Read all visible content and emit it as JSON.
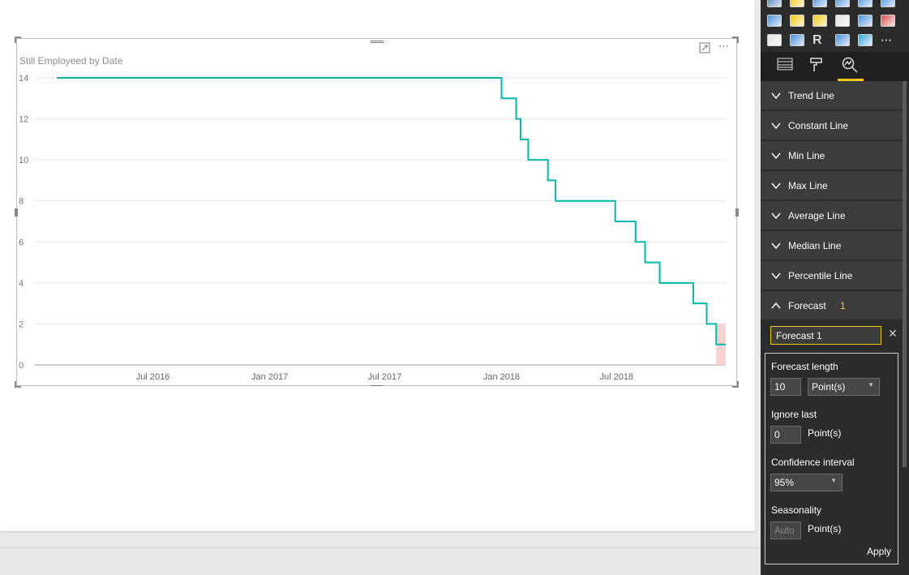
{
  "visual": {
    "title": "Still Employeed by Date",
    "header_icons": {
      "focus": "focus-mode-icon",
      "more": "more-options-icon"
    }
  },
  "chart_data": {
    "type": "line",
    "title": "Still Employeed by Date",
    "xlabel": "",
    "ylabel": "",
    "x_tick_labels": [
      "Jul 2016",
      "Jan 2017",
      "Jul 2017",
      "Jan 2018",
      "Jul 2018"
    ],
    "y_tick_labels": [
      "0",
      "2",
      "4",
      "6",
      "8",
      "10",
      "12",
      "14"
    ],
    "ylim": [
      0,
      14
    ],
    "xlim": [
      "2016-01-15",
      "2018-12-20"
    ],
    "grid": true,
    "line_color": "#01b8aa",
    "series": [
      {
        "step": true,
        "points": [
          [
            "2016-02-01",
            14
          ],
          [
            "2017-12-29",
            14
          ],
          [
            "2018-01-01",
            13
          ],
          [
            "2018-01-24",
            12
          ],
          [
            "2018-01-31",
            11
          ],
          [
            "2018-02-12",
            10
          ],
          [
            "2018-03-15",
            9
          ],
          [
            "2018-03-27",
            8
          ],
          [
            "2018-06-29",
            7
          ],
          [
            "2018-07-31",
            6
          ],
          [
            "2018-08-15",
            5
          ],
          [
            "2018-09-07",
            4
          ],
          [
            "2018-10-30",
            3
          ],
          [
            "2018-11-20",
            2
          ],
          [
            "2018-12-05",
            1
          ],
          [
            "2018-12-20",
            1
          ]
        ]
      }
    ],
    "forecast_band": {
      "start": "2018-12-05",
      "end": "2018-12-20",
      "low": 0,
      "high": 2,
      "color": "#f9d2d2"
    }
  },
  "pane": {
    "gallery_icons": [
      "scatter-chart-icon",
      "pie-chart-icon",
      "map-icon",
      "globe-icon",
      "table-icon",
      "matrix-icon",
      "filled-map-icon",
      "funnel-icon",
      "gauge-icon",
      "card-icon",
      "multi-row-card-icon",
      "kpi-icon",
      "slicer-icon",
      "donut-chart-icon",
      "r-visual-icon",
      "shape-map-icon",
      "arcgis-globe-icon",
      "more-visuals-icon"
    ],
    "tabs": [
      {
        "name": "fields-tab",
        "icon": "fields-icon"
      },
      {
        "name": "format-tab",
        "icon": "paint-roller-icon"
      },
      {
        "name": "analytics-tab",
        "icon": "analytics-magnifier-icon"
      }
    ],
    "cards": [
      {
        "label": "Trend Line",
        "expanded": false
      },
      {
        "label": "Constant Line",
        "expanded": false
      },
      {
        "label": "Min Line",
        "expanded": false
      },
      {
        "label": "Max Line",
        "expanded": false
      },
      {
        "label": "Average Line",
        "expanded": false
      },
      {
        "label": "Median Line",
        "expanded": false
      },
      {
        "label": "Percentile Line",
        "expanded": false
      },
      {
        "label": "Forecast",
        "expanded": true,
        "count": "1"
      }
    ],
    "forecast": {
      "name": "Forecast 1",
      "length_label": "Forecast length",
      "length_value": "10",
      "length_unit": "Point(s)",
      "ignore_label": "Ignore last",
      "ignore_value": "0",
      "ignore_unit": "Point(s)",
      "confidence_label": "Confidence interval",
      "confidence_value": "95%",
      "seasonality_label": "Seasonality",
      "seasonality_placeholder": "Auto",
      "seasonality_unit": "Point(s)",
      "apply_label": "Apply"
    },
    "accent_color": "#f2c811"
  }
}
